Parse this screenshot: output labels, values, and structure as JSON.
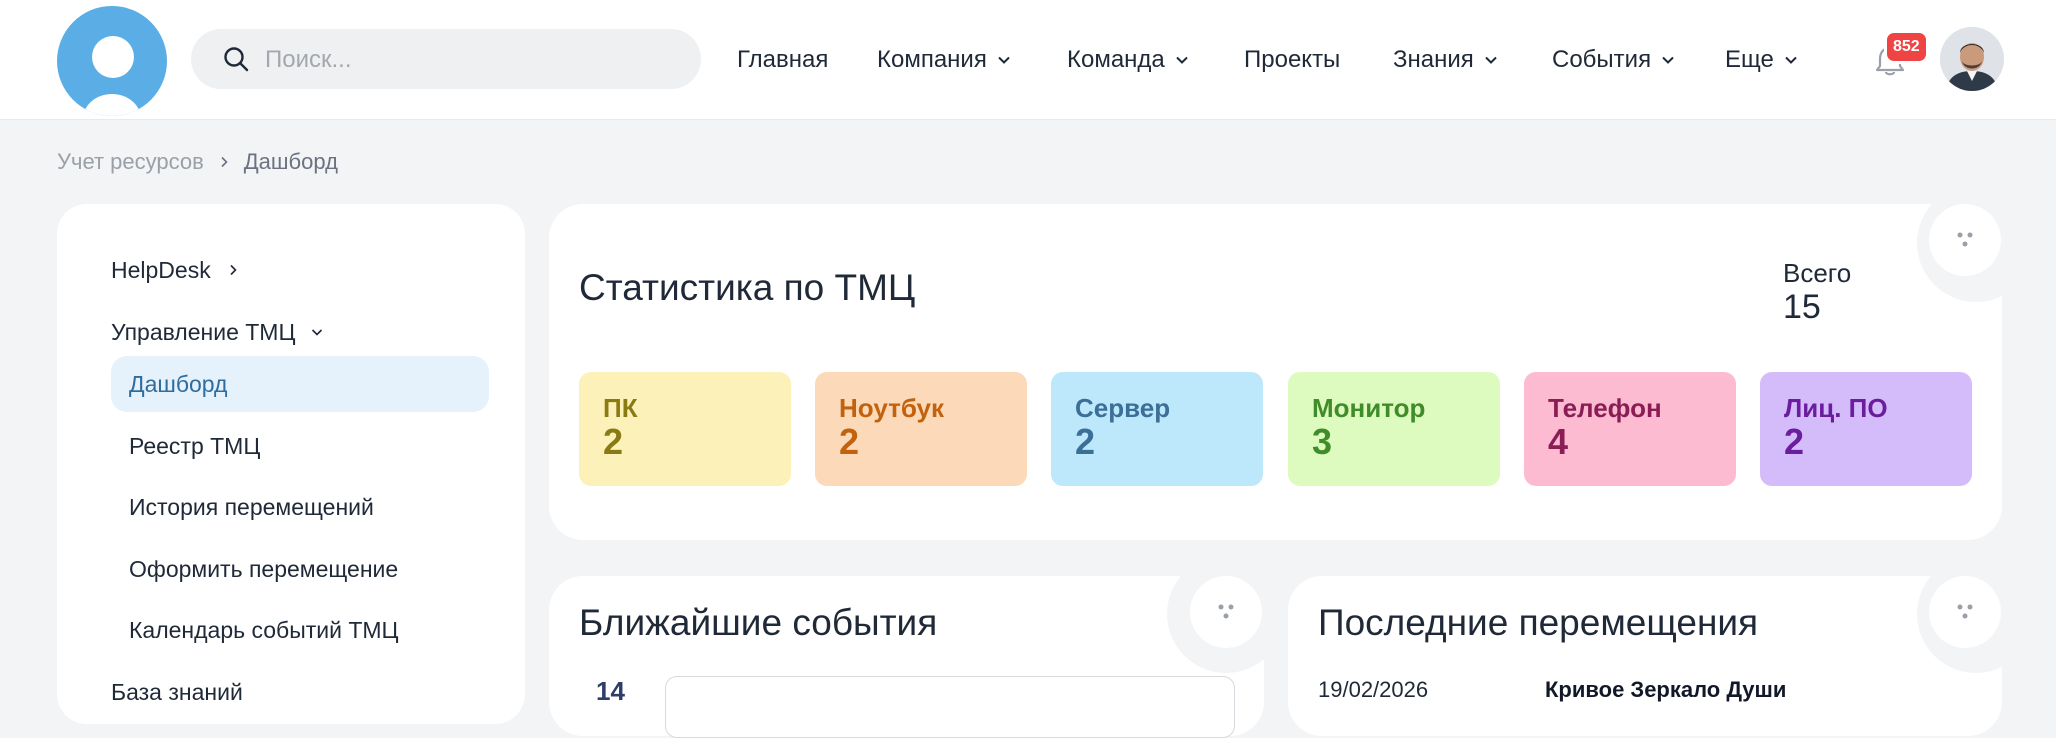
{
  "header": {
    "search_placeholder": "Поиск...",
    "nav": [
      {
        "label": "Главная",
        "has_dropdown": false
      },
      {
        "label": "Компания",
        "has_dropdown": true
      },
      {
        "label": "Команда",
        "has_dropdown": true
      },
      {
        "label": "Проекты",
        "has_dropdown": false
      },
      {
        "label": "Знания",
        "has_dropdown": true
      },
      {
        "label": "События",
        "has_dropdown": true
      },
      {
        "label": "Еще",
        "has_dropdown": true
      }
    ],
    "notifications_count": "852",
    "icons": {
      "search": "search-icon",
      "bell": "bell-icon",
      "chevron": "chevron-down-icon"
    }
  },
  "breadcrumb": {
    "parent": "Учет ресурсов",
    "current": "Дашборд"
  },
  "sidebar": {
    "items": [
      {
        "label": "HelpDesk"
      },
      {
        "label": "Управление ТМЦ"
      }
    ],
    "sub_items": [
      {
        "label": "Дашборд",
        "active": true
      },
      {
        "label": "Реестр ТМЦ",
        "active": false
      },
      {
        "label": "История перемещений",
        "active": false
      },
      {
        "label": "Оформить перемещение",
        "active": false
      },
      {
        "label": "Календарь событий ТМЦ",
        "active": false
      }
    ],
    "bottom_item": {
      "label": "База знаний"
    }
  },
  "stats_card": {
    "title": "Статистика по ТМЦ",
    "total_label": "Всего",
    "total_value": "15",
    "categories": [
      {
        "label": "ПК",
        "value": "2",
        "bg": "#fcf1b8",
        "fg": "#8a7a14"
      },
      {
        "label": "Ноутбук",
        "value": "2",
        "bg": "#fcd9b8",
        "fg": "#c2620e"
      },
      {
        "label": "Сервер",
        "value": "2",
        "bg": "#bde7fb",
        "fg": "#3b6f97"
      },
      {
        "label": "Монитор",
        "value": "3",
        "bg": "#ddfbbf",
        "fg": "#3f8c28"
      },
      {
        "label": "Телефон",
        "value": "4",
        "bg": "#fcbbd0",
        "fg": "#8a1d55"
      },
      {
        "label": "Лиц. ПО",
        "value": "2",
        "bg": "#d4bcfb",
        "fg": "#6b1d9e"
      }
    ]
  },
  "events_card": {
    "title": "Ближайшие события",
    "first_date": "14"
  },
  "moves_card": {
    "title": "Последние перемещения",
    "first_date": "19/02/2026",
    "first_name": "Кривое Зеркало Души"
  },
  "colors": {
    "accent": "#5aaee5",
    "badge": "#ef4444",
    "active_bg": "#e5f1fb",
    "page_bg": "#f3f4f6"
  }
}
